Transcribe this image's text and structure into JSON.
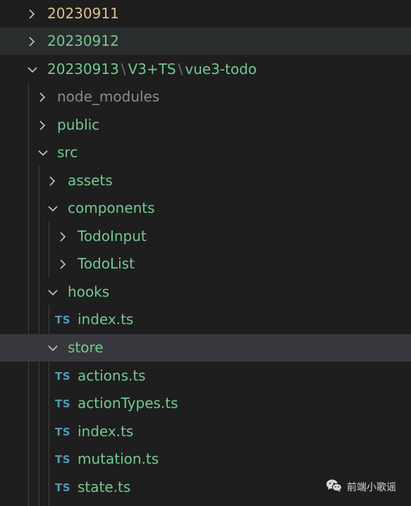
{
  "explorer": {
    "items": [
      {
        "label": "20230911",
        "type": "folder",
        "expanded": false,
        "depth": 0,
        "color": "yellow"
      },
      {
        "label": "20230912",
        "type": "folder",
        "expanded": false,
        "depth": 0,
        "color": "green",
        "highlighted": true
      },
      {
        "label_parts": [
          "20230913",
          "V3+TS",
          "vue3-todo"
        ],
        "type": "folder",
        "expanded": true,
        "depth": 0,
        "color": "green"
      },
      {
        "label": "node_modules",
        "type": "folder",
        "expanded": false,
        "depth": 1,
        "color": "gray"
      },
      {
        "label": "public",
        "type": "folder",
        "expanded": false,
        "depth": 1,
        "color": "green"
      },
      {
        "label": "src",
        "type": "folder",
        "expanded": true,
        "depth": 1,
        "color": "green"
      },
      {
        "label": "assets",
        "type": "folder",
        "expanded": false,
        "depth": 2,
        "color": "green"
      },
      {
        "label": "components",
        "type": "folder",
        "expanded": true,
        "depth": 2,
        "color": "green"
      },
      {
        "label": "TodoInput",
        "type": "folder",
        "expanded": false,
        "depth": 3,
        "color": "green"
      },
      {
        "label": "TodoList",
        "type": "folder",
        "expanded": false,
        "depth": 3,
        "color": "green"
      },
      {
        "label": "hooks",
        "type": "folder",
        "expanded": true,
        "depth": 2,
        "color": "green"
      },
      {
        "label": "index.ts",
        "type": "file",
        "icon": "TS",
        "depth": 3,
        "color": "green"
      },
      {
        "label": "store",
        "type": "folder",
        "expanded": true,
        "depth": 2,
        "color": "green",
        "selected": true
      },
      {
        "label": "actions.ts",
        "type": "file",
        "icon": "TS",
        "depth": 3,
        "color": "green"
      },
      {
        "label": "actionTypes.ts",
        "type": "file",
        "icon": "TS",
        "depth": 3,
        "color": "green"
      },
      {
        "label": "index.ts",
        "type": "file",
        "icon": "TS",
        "depth": 3,
        "color": "green"
      },
      {
        "label": "mutation.ts",
        "type": "file",
        "icon": "TS",
        "depth": 3,
        "color": "green"
      },
      {
        "label": "state.ts",
        "type": "file",
        "icon": "TS",
        "depth": 3,
        "color": "green"
      }
    ]
  },
  "watermark": {
    "text": "前端小歌谣",
    "icon": "wechat-icon"
  },
  "colors": {
    "background": "#1e1e1e",
    "highlight": "#2a2d2e",
    "selected": "#37373d",
    "yellow": "#e2c08d",
    "green": "#73c991",
    "gray": "#8c8c8c",
    "ts_icon": "#519aba",
    "chevron": "#c5c5c5",
    "guide": "#404040"
  }
}
